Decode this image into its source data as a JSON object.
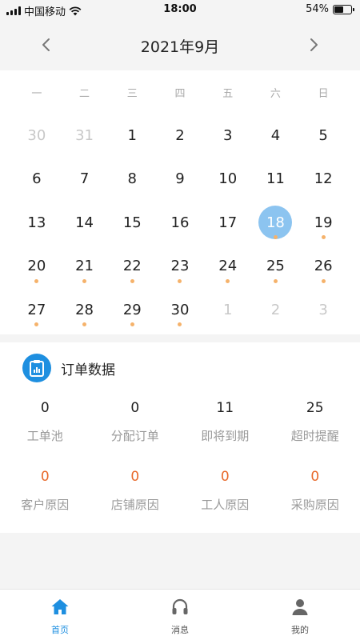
{
  "status_bar": {
    "carrier": "中国移动",
    "time": "18:00",
    "battery_text": "54%",
    "battery_level": 0.54,
    "icons": [
      "signal-icon",
      "wifi-icon",
      "battery-icon"
    ]
  },
  "calendar": {
    "title": "2021年9月",
    "prev_icon": "chevron-left-icon",
    "next_icon": "chevron-right-icon",
    "weekdays": [
      "一",
      "二",
      "三",
      "四",
      "五",
      "六",
      "日"
    ],
    "days": [
      {
        "label": "30",
        "muted": true,
        "dot": false
      },
      {
        "label": "31",
        "muted": true,
        "dot": false
      },
      {
        "label": "1",
        "muted": false,
        "dot": false
      },
      {
        "label": "2",
        "muted": false,
        "dot": false
      },
      {
        "label": "3",
        "muted": false,
        "dot": false
      },
      {
        "label": "4",
        "muted": false,
        "dot": false
      },
      {
        "label": "5",
        "muted": false,
        "dot": false
      },
      {
        "label": "6",
        "muted": false,
        "dot": false
      },
      {
        "label": "7",
        "muted": false,
        "dot": false
      },
      {
        "label": "8",
        "muted": false,
        "dot": false
      },
      {
        "label": "9",
        "muted": false,
        "dot": false
      },
      {
        "label": "10",
        "muted": false,
        "dot": false
      },
      {
        "label": "11",
        "muted": false,
        "dot": false
      },
      {
        "label": "12",
        "muted": false,
        "dot": false
      },
      {
        "label": "13",
        "muted": false,
        "dot": false
      },
      {
        "label": "14",
        "muted": false,
        "dot": false
      },
      {
        "label": "15",
        "muted": false,
        "dot": false
      },
      {
        "label": "16",
        "muted": false,
        "dot": false
      },
      {
        "label": "17",
        "muted": false,
        "dot": false
      },
      {
        "label": "18",
        "muted": false,
        "dot": true,
        "selected": true
      },
      {
        "label": "19",
        "muted": false,
        "dot": true
      },
      {
        "label": "20",
        "muted": false,
        "dot": true
      },
      {
        "label": "21",
        "muted": false,
        "dot": true
      },
      {
        "label": "22",
        "muted": false,
        "dot": true
      },
      {
        "label": "23",
        "muted": false,
        "dot": true
      },
      {
        "label": "24",
        "muted": false,
        "dot": true
      },
      {
        "label": "25",
        "muted": false,
        "dot": true
      },
      {
        "label": "26",
        "muted": false,
        "dot": true
      },
      {
        "label": "27",
        "muted": false,
        "dot": true
      },
      {
        "label": "28",
        "muted": false,
        "dot": true
      },
      {
        "label": "29",
        "muted": false,
        "dot": true
      },
      {
        "label": "30",
        "muted": false,
        "dot": true
      },
      {
        "label": "1",
        "muted": true,
        "dot": false
      },
      {
        "label": "2",
        "muted": true,
        "dot": false
      },
      {
        "label": "3",
        "muted": true,
        "dot": false
      }
    ],
    "colors": {
      "selected": "#8cc4f0",
      "dot": "#f5b26b",
      "muted": "#c8c8c8"
    }
  },
  "orders": {
    "title": "订单数据",
    "icon": "clipboard-chart-icon",
    "row1": [
      {
        "value": "0",
        "label": "工单池"
      },
      {
        "value": "0",
        "label": "分配订单"
      },
      {
        "value": "11",
        "label": "即将到期"
      },
      {
        "value": "25",
        "label": "超时提醒"
      }
    ],
    "row2": [
      {
        "value": "0",
        "label": "客户原因"
      },
      {
        "value": "0",
        "label": "店铺原因"
      },
      {
        "value": "0",
        "label": "工人原因"
      },
      {
        "value": "0",
        "label": "采购原因"
      }
    ],
    "colors": {
      "accent": "#1e8fe0",
      "reason_value": "#e86a2c"
    }
  },
  "tab_bar": {
    "tabs": [
      {
        "label": "首页",
        "icon": "home-icon",
        "active": true
      },
      {
        "label": "消息",
        "icon": "headset-icon",
        "active": false
      },
      {
        "label": "我的",
        "icon": "user-icon",
        "active": false
      }
    ]
  }
}
